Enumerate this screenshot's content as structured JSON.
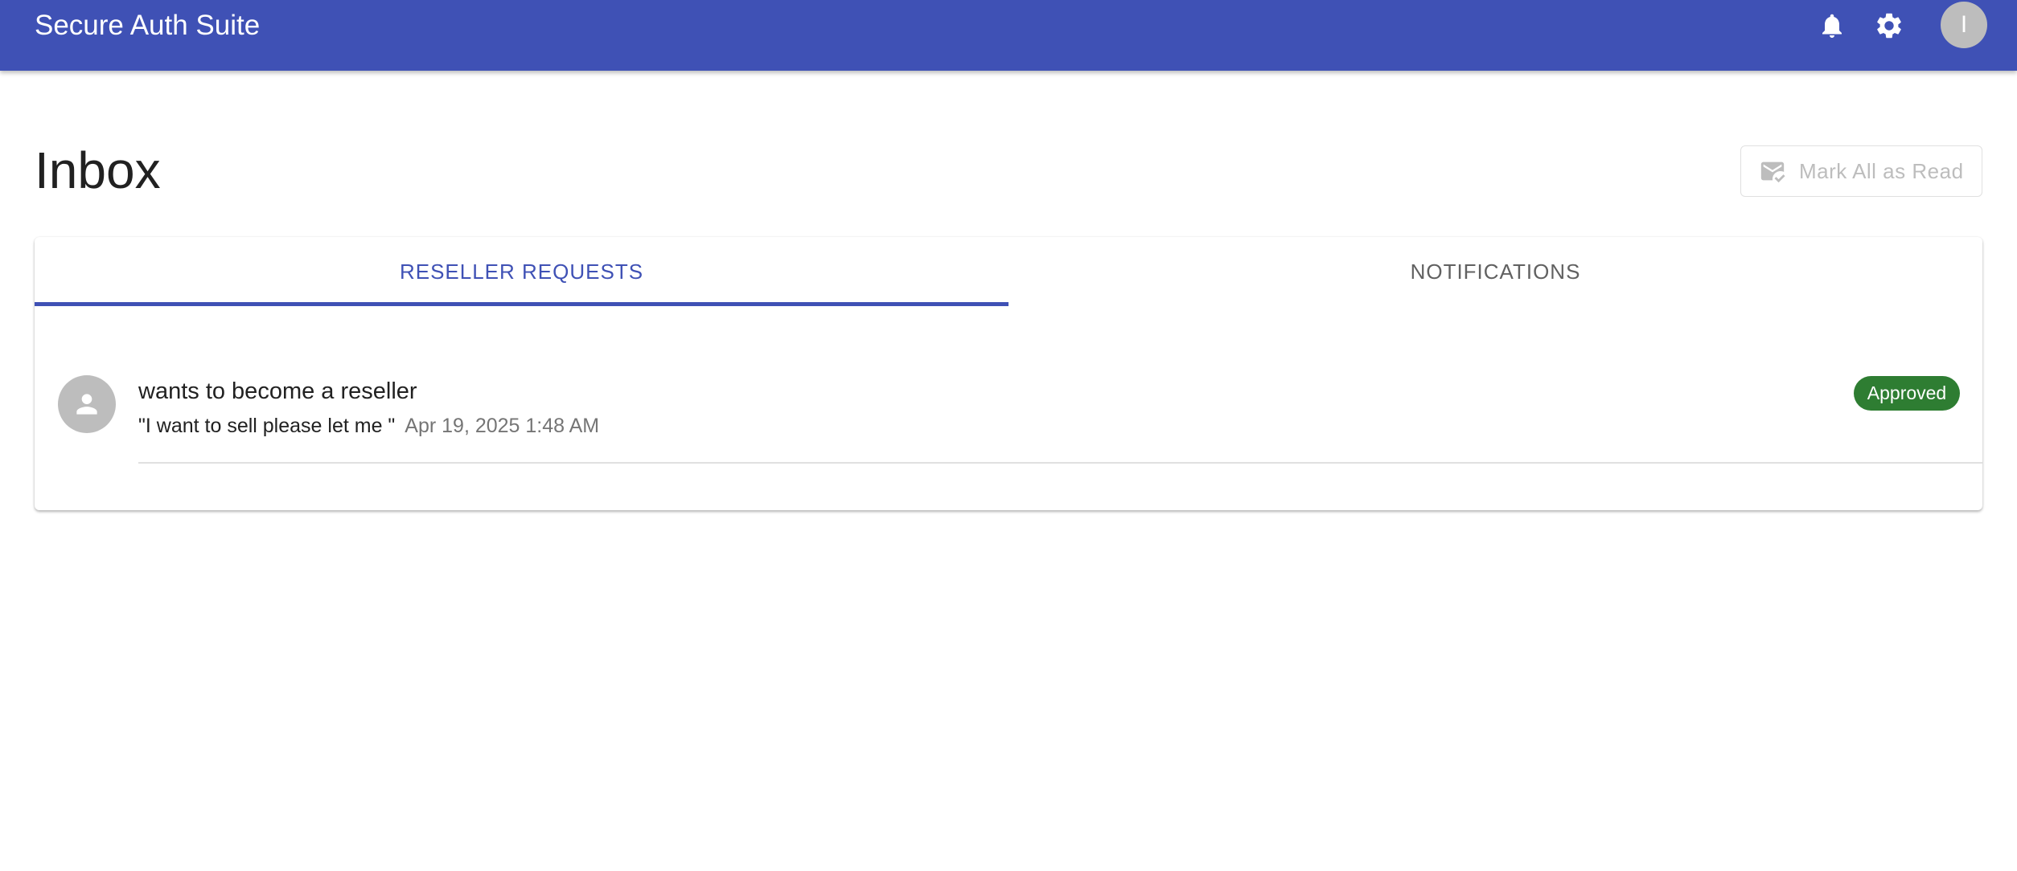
{
  "appbar": {
    "title": "Secure Auth Suite",
    "avatar_initial": "I",
    "icons": [
      "bell-icon",
      "gear-icon"
    ],
    "color": "#3f51b5"
  },
  "page": {
    "title": "Inbox",
    "mark_all_label": "Mark All as Read"
  },
  "tabs": [
    {
      "label": "RESELLER REQUESTS",
      "selected": true
    },
    {
      "label": "NOTIFICATIONS",
      "selected": false
    }
  ],
  "requests": [
    {
      "title": "wants to become a reseller",
      "message": "\"I want to sell please let me \"",
      "timestamp": "Apr 19, 2025 1:48 AM",
      "status": "Approved",
      "status_color": "#2e7d32"
    }
  ]
}
